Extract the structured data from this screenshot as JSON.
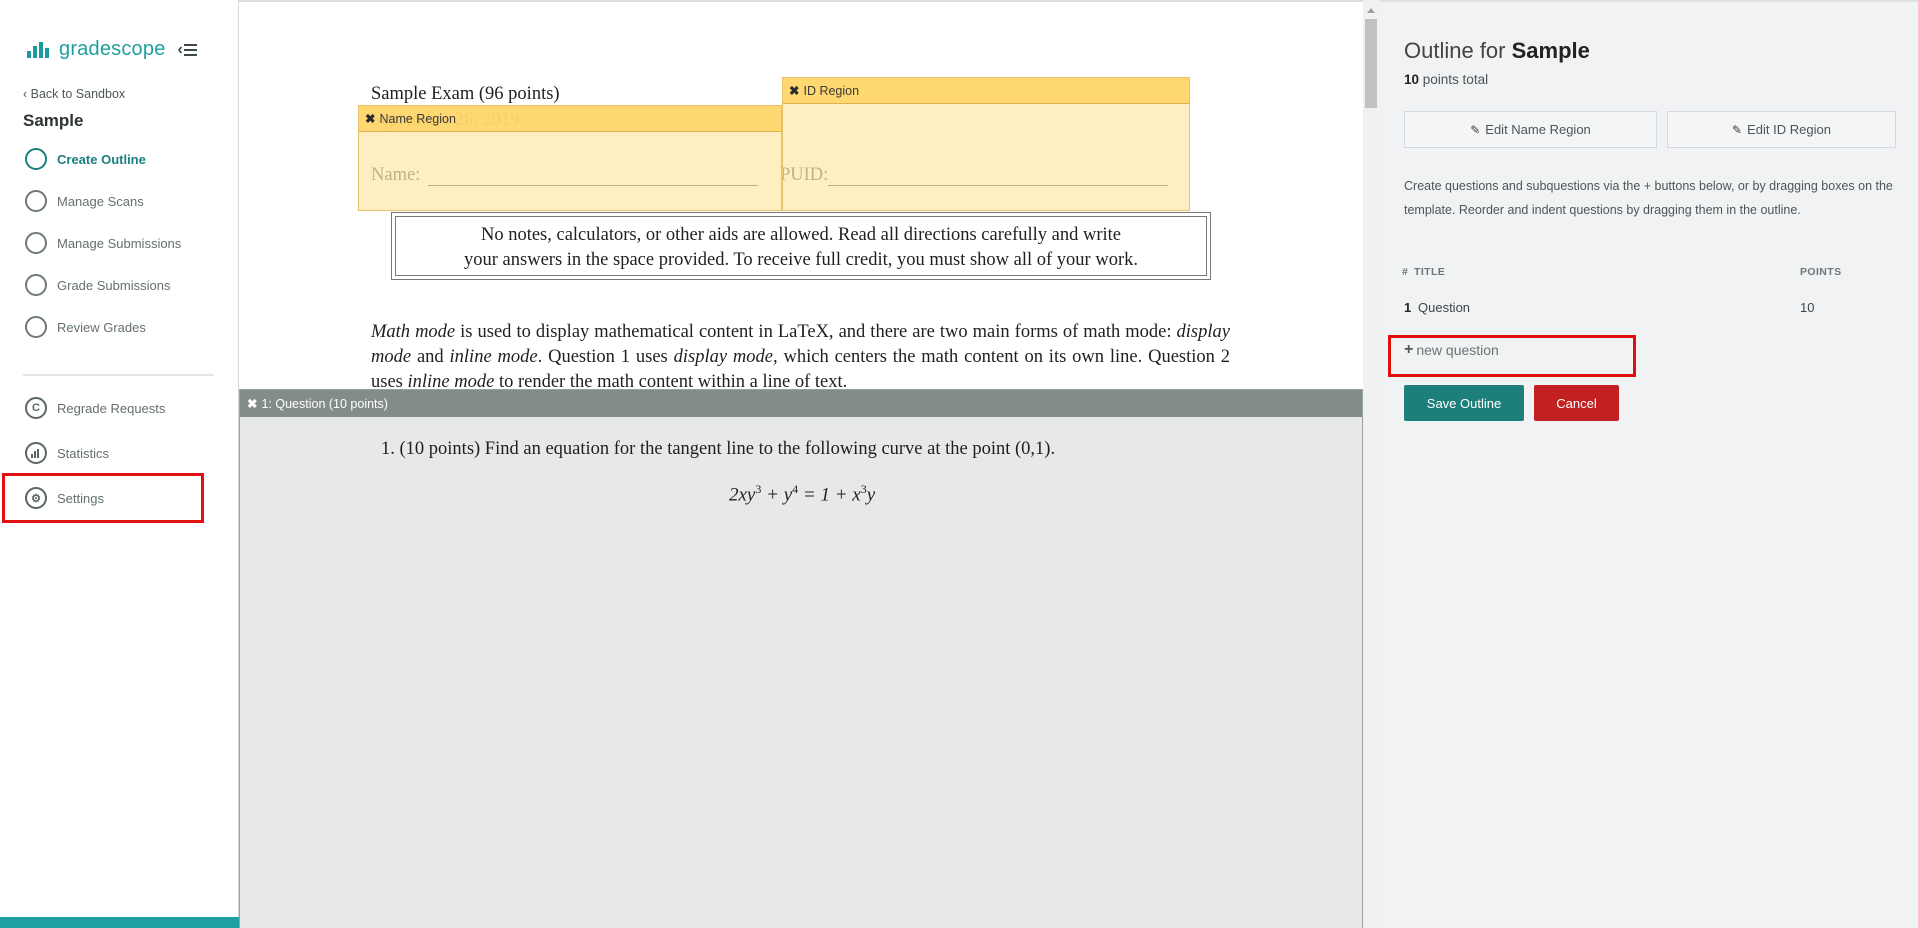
{
  "sidebar": {
    "logo_text": "gradescope",
    "back_link": "Back to Sandbox",
    "course_title": "Sample",
    "workflow_items": [
      {
        "label": "Create Outline",
        "active": true
      },
      {
        "label": "Manage Scans",
        "active": false
      },
      {
        "label": "Manage Submissions",
        "active": false
      },
      {
        "label": "Grade Submissions",
        "active": false
      },
      {
        "label": "Review Grades",
        "active": false
      }
    ],
    "tool_items": [
      {
        "label": "Regrade Requests",
        "icon": "regrade-icon"
      },
      {
        "label": "Statistics",
        "icon": "statistics-icon"
      },
      {
        "label": "Settings",
        "icon": "gear-icon"
      }
    ]
  },
  "document": {
    "exam_title": "Sample Exam (96 points)",
    "exam_date": "September 26, 2019",
    "name_label": "Name:",
    "puid_label": "PUID:",
    "notice_line1": "No notes, calculators, or other aids are allowed. Read all directions carefully and write",
    "notice_line2": "your answers in the space provided. To receive full credit, you must show all of your work.",
    "para": {
      "p1": "Math mode",
      "p2": " is used to display mathematical content in LaTeX, and there are two main forms of math mode: ",
      "p3": "display mode",
      "p4": " and ",
      "p5": "inline mode",
      "p6": ". Question 1 uses ",
      "p7": "display mode",
      "p8": ", which centers the math content on its own line. Question 2 uses ",
      "p9": "inline mode",
      "p10": " to render the math content within a line of text."
    },
    "question_text": "1.  (10 points)  Find an equation for the tangent line to the following curve at the point (0,1).",
    "equation": {
      "a": "2xy",
      "a_exp": "3",
      "b": " + y",
      "b_exp": "4",
      "c": " = 1 + x",
      "c_exp": "3",
      "d": "y"
    }
  },
  "regions": {
    "name_region_label": "Name Region",
    "id_region_label": "ID Region",
    "question_region_label": "1: Question (10 points)"
  },
  "outline": {
    "title_prefix": "Outline for ",
    "title_name": "Sample",
    "points_value": "10",
    "points_suffix": " points total",
    "edit_name_region": "Edit Name Region",
    "edit_id_region": "Edit ID Region",
    "help_text": "Create questions and subquestions via the + buttons below, or by dragging boxes on the template. Reorder and indent questions by dragging them in the outline.",
    "col_num": "#",
    "col_title": "TITLE",
    "col_points": "POINTS",
    "questions": [
      {
        "num": "1",
        "title": "Question",
        "points": "10"
      }
    ],
    "new_question": "new question",
    "save_label": "Save Outline",
    "cancel_label": "Cancel"
  },
  "colors": {
    "brand": "#1fa0a0",
    "save": "#1c7f7a",
    "cancel": "#c22021",
    "highlight": "#e01010"
  }
}
